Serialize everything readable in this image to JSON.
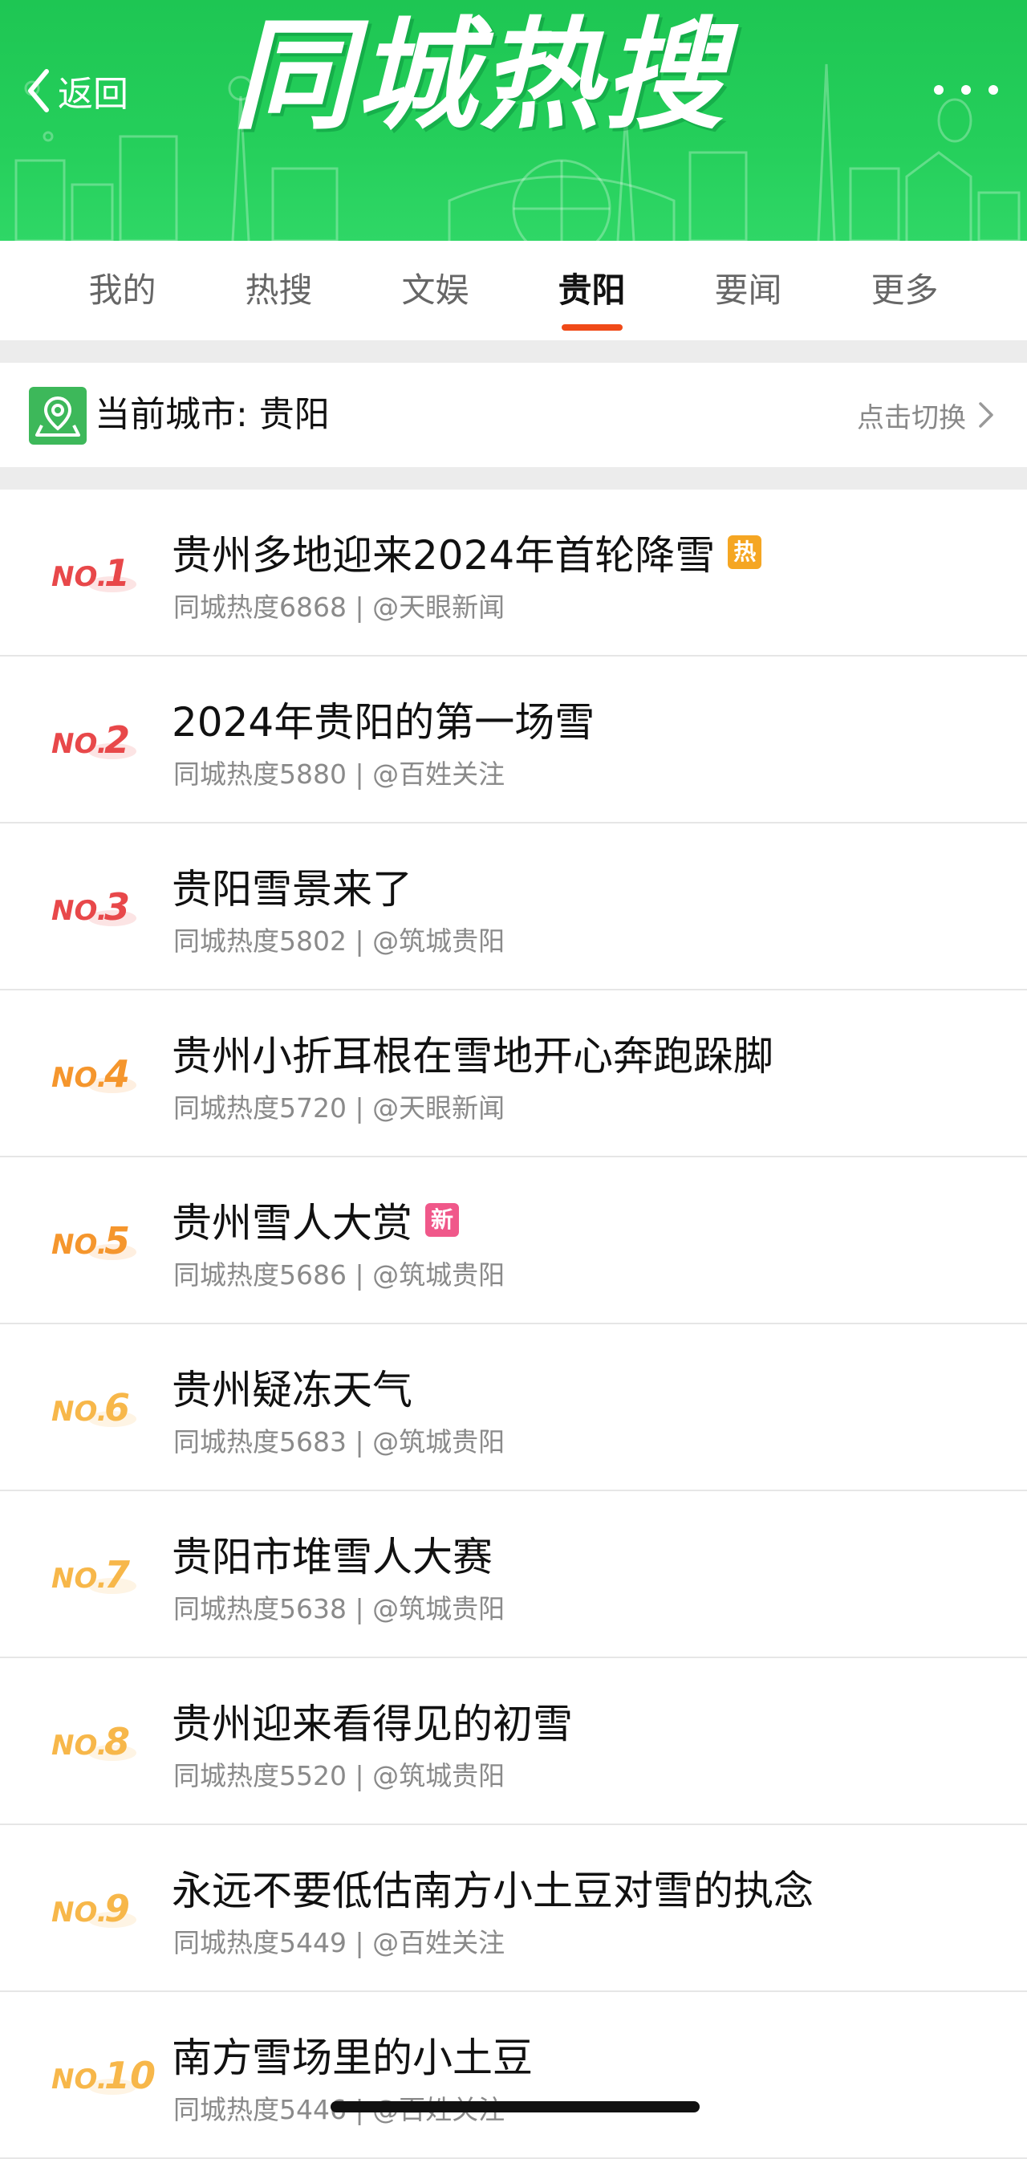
{
  "header": {
    "back_label": "返回",
    "title": "同城热搜",
    "bg_color": "#25cf5b"
  },
  "tabs": [
    {
      "label": "我的",
      "active": false
    },
    {
      "label": "热搜",
      "active": false
    },
    {
      "label": "文娱",
      "active": false
    },
    {
      "label": "贵阳",
      "active": true
    },
    {
      "label": "要闻",
      "active": false
    },
    {
      "label": "更多",
      "active": false
    }
  ],
  "city_bar": {
    "label": "当前城市: 贵阳",
    "switch_label": "点击切换",
    "icon": "map-pin-icon"
  },
  "rank_colors": {
    "top": "#e8484a",
    "mid": "#f5962d",
    "low": "#f7b74a"
  },
  "items": [
    {
      "rank": "1",
      "title": "贵州多地迎来2024年首轮降雪",
      "meta": "同城热度6868 | @天眼新闻",
      "badge": "热",
      "badge_color": "#f5a623"
    },
    {
      "rank": "2",
      "title": "2024年贵阳的第一场雪",
      "meta": "同城热度5880 | @百姓关注",
      "badge": "",
      "badge_color": ""
    },
    {
      "rank": "3",
      "title": "贵阳雪景来了",
      "meta": "同城热度5802 | @筑城贵阳",
      "badge": "",
      "badge_color": ""
    },
    {
      "rank": "4",
      "title": "贵州小折耳根在雪地开心奔跑跺脚",
      "meta": "同城热度5720 | @天眼新闻",
      "badge": "",
      "badge_color": ""
    },
    {
      "rank": "5",
      "title": "贵州雪人大赏",
      "meta": "同城热度5686 | @筑城贵阳",
      "badge": "新",
      "badge_color": "#f0588a"
    },
    {
      "rank": "6",
      "title": "贵州疑冻天气",
      "meta": "同城热度5683 | @筑城贵阳",
      "badge": "",
      "badge_color": ""
    },
    {
      "rank": "7",
      "title": "贵阳市堆雪人大赛",
      "meta": "同城热度5638 | @筑城贵阳",
      "badge": "",
      "badge_color": ""
    },
    {
      "rank": "8",
      "title": "贵州迎来看得见的初雪",
      "meta": "同城热度5520 | @筑城贵阳",
      "badge": "",
      "badge_color": ""
    },
    {
      "rank": "9",
      "title": "永远不要低估南方小土豆对雪的执念",
      "meta": "同城热度5449 | @百姓关注",
      "badge": "",
      "badge_color": ""
    },
    {
      "rank": "10",
      "title": "南方雪场里的小土豆",
      "meta": "同城热度5446 | @百姓关注",
      "badge": "",
      "badge_color": ""
    }
  ]
}
